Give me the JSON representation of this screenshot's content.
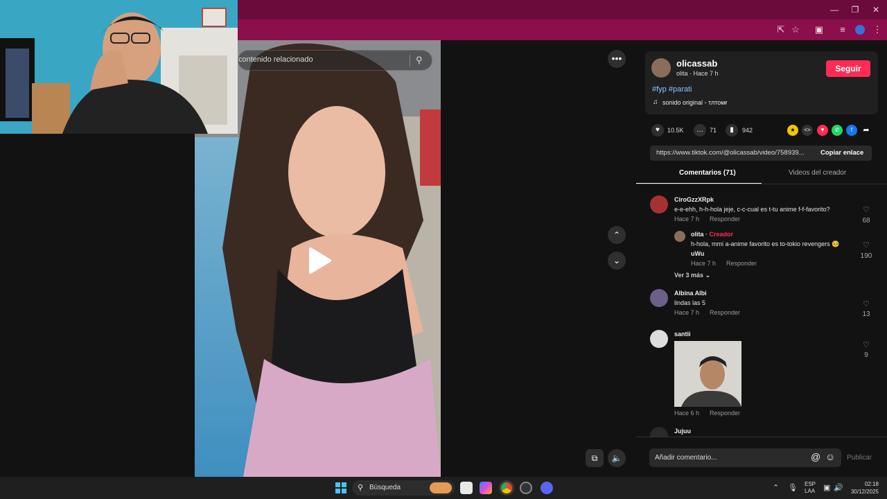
{
  "colors": {
    "title_bar": "#6b0b3c",
    "toolbar": "#8a0f4b",
    "accent": "#fe2c55",
    "hashtag": "#8fc1ff",
    "creator": "#fe2c55"
  },
  "video": {
    "search_placeholder": "contenido relacionado"
  },
  "post": {
    "username": "olicassab",
    "subline": "olita · Hace 7 h",
    "follow_label": "Seguir",
    "hashtags": "#fyp #parati",
    "sound": "sonido original - тлтомғ",
    "likes": "10.5K",
    "comments": "71",
    "saves": "942",
    "link": "https://www.tiktok.com/@olicassab/video/758939...",
    "copy_label": "Copiar enlace"
  },
  "tabs": {
    "comments": "Comentarios (71)",
    "creator_videos": "Videos del creador"
  },
  "comments": [
    {
      "user": "CiroGzzXRpk",
      "text": "e-e-ehh, h-h-hola jeje, c-c-cual es t-tu anime f-f-favorito?",
      "time": "Hace 7 h",
      "reply": "Responder",
      "likes": "68"
    },
    {
      "user": "olita",
      "badge": "Creador",
      "text1": "h-hola, mmi a-anime favorito es to-tokio revengers 🥺",
      "text2": "uWu",
      "time": "Hace 7 h",
      "reply": "Responder",
      "likes": "190"
    },
    {
      "more": "Ver 3 más"
    },
    {
      "user": "Albina Albi",
      "text": "lindas las 5",
      "time": "Hace 7 h",
      "reply": "Responder",
      "likes": "13"
    },
    {
      "user": "santii",
      "time": "Hace 6 h",
      "reply": "Responder",
      "likes": "9"
    },
    {
      "user": "Jujuu"
    }
  ],
  "comment_box": {
    "placeholder": "Añadir comentario...",
    "publish": "Publicar"
  },
  "taskbar": {
    "search": "Búsqueda",
    "lang1": "ESP",
    "lang2": "LAA",
    "time": "02:18",
    "date": "30/12/2025"
  }
}
